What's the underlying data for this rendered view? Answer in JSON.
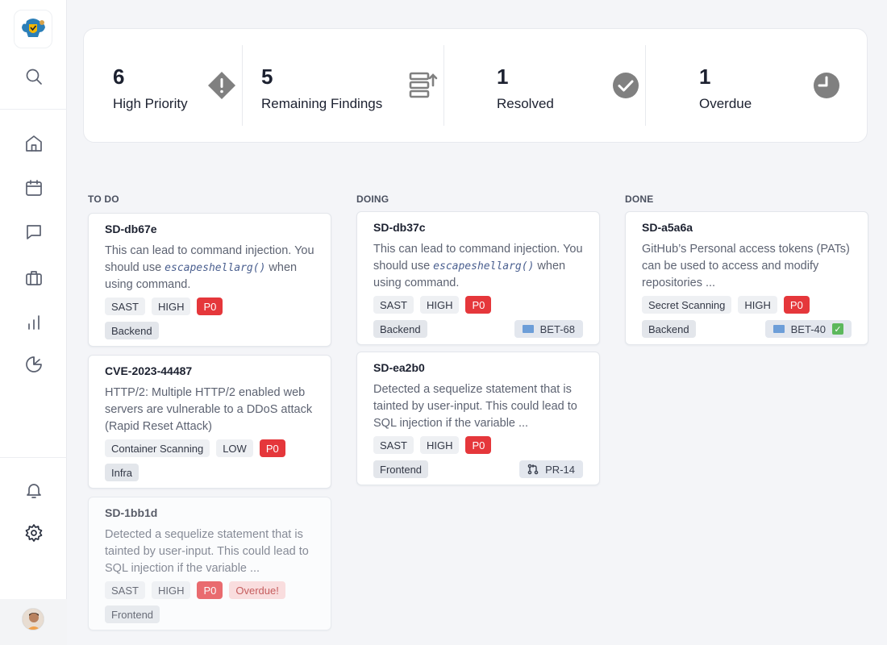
{
  "stats": [
    {
      "value": "6",
      "label": "High Priority",
      "icon": "warning-diamond-icon"
    },
    {
      "value": "5",
      "label": "Remaining Findings",
      "icon": "server-icon"
    },
    {
      "value": "1",
      "label": "Resolved",
      "icon": "check-circle-icon"
    },
    {
      "value": "1",
      "label": "Overdue",
      "icon": "clock-icon"
    }
  ],
  "columns": {
    "todo": "TO DO",
    "doing": "DOING",
    "done": "DONE"
  },
  "cards": {
    "c1": {
      "id": "SD-db67e",
      "desc_pre": "This can lead to command injection. You should use ",
      "desc_code": "escapeshellarg()",
      "desc_post": " when using command.",
      "tags": [
        "SAST",
        "HIGH",
        "P0"
      ],
      "team": "Backend"
    },
    "c2": {
      "id": "CVE-2023-44487",
      "desc": "HTTP/2: Multiple HTTP/2 enabled web servers are vulnerable to a DDoS attack (Rapid Reset Attack)",
      "tags": [
        "Container Scanning",
        "LOW",
        "P0"
      ],
      "team": "Infra"
    },
    "c3": {
      "id": "SD-1bb1d",
      "desc": "Detected a sequelize statement that is tainted by user-input. This could lead to SQL injection if the variable ...",
      "tags": [
        "SAST",
        "HIGH",
        "P0",
        "Overdue!"
      ],
      "team": "Frontend"
    },
    "c4": {
      "id": "SD-db37c",
      "desc_pre": "This can lead to command injection. You should use ",
      "desc_code": "escapeshellarg()",
      "desc_post": " when using command.",
      "tags": [
        "SAST",
        "HIGH",
        "P0"
      ],
      "team": "Backend",
      "ticket": "BET-68"
    },
    "c5": {
      "id": "SD-ea2b0",
      "desc": "Detected a sequelize statement that is tainted by user-input. This could lead to SQL injection if the variable ...",
      "tags": [
        "SAST",
        "HIGH",
        "P0"
      ],
      "team": "Frontend",
      "ticket": "PR-14"
    },
    "c6": {
      "id": "SD-a5a6a",
      "desc": "GitHub’s Personal access tokens (PATs) can be used to access and modify repositories ...",
      "tags": [
        "Secret Scanning",
        "HIGH",
        "P0"
      ],
      "team": "Backend",
      "ticket": "BET-40"
    }
  }
}
